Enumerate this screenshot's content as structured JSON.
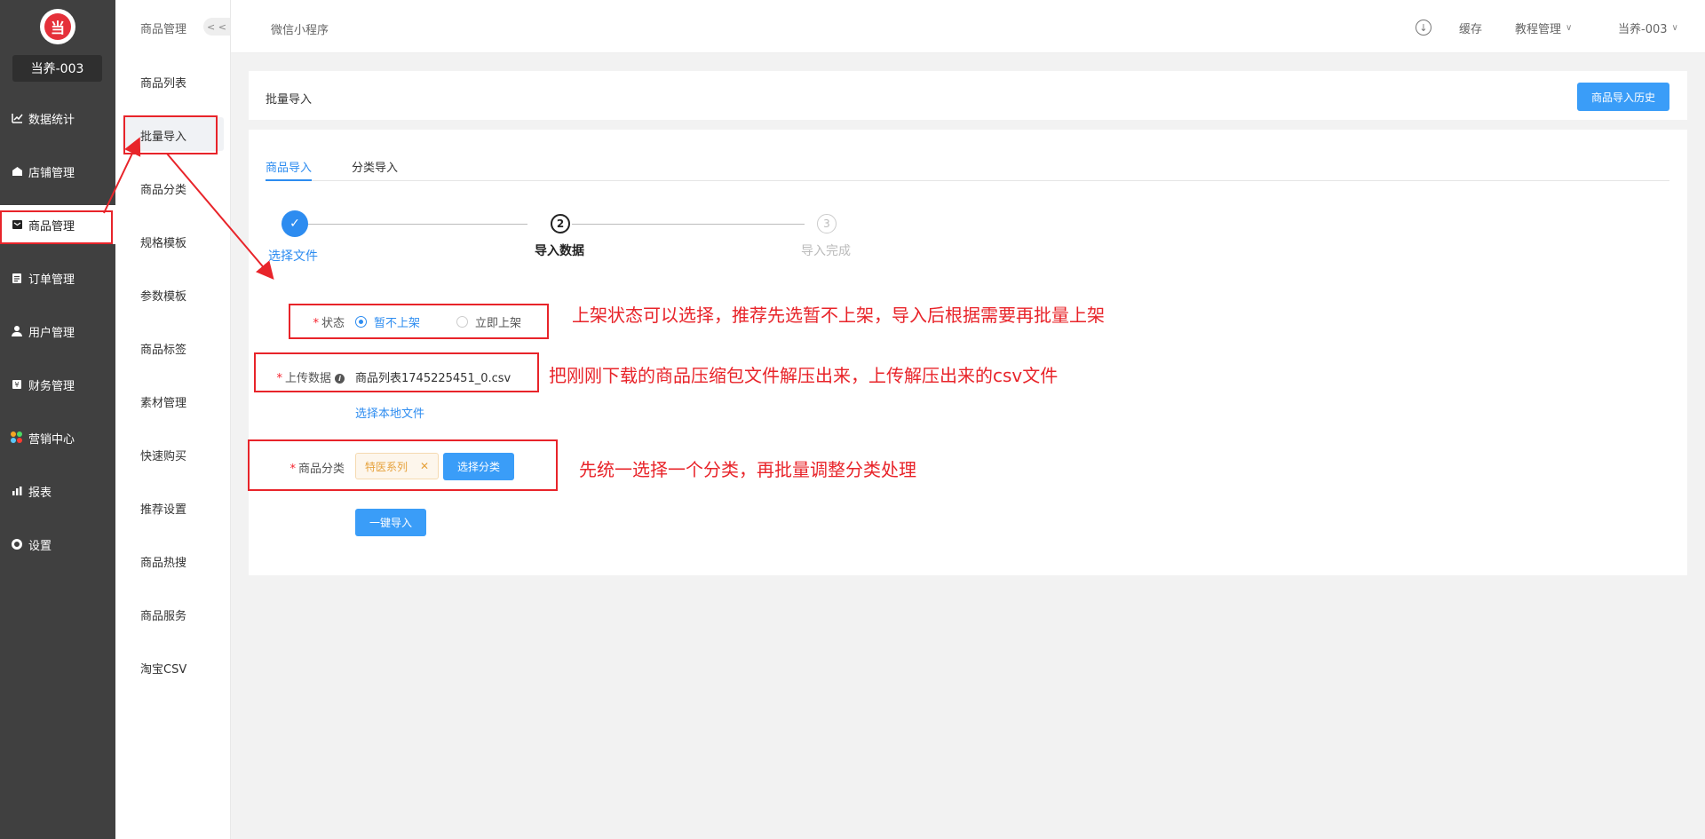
{
  "app": {
    "logo_text": "当",
    "store_name": "当养-003"
  },
  "sidebar": {
    "items": [
      {
        "label": "数据统计",
        "icon": "chart-icon"
      },
      {
        "label": "店铺管理",
        "icon": "store-icon"
      },
      {
        "label": "商品管理",
        "icon": "goods-icon"
      },
      {
        "label": "订单管理",
        "icon": "order-icon"
      },
      {
        "label": "用户管理",
        "icon": "user-icon"
      },
      {
        "label": "财务管理",
        "icon": "finance-icon"
      },
      {
        "label": "营销中心",
        "icon": "marketing-icon"
      },
      {
        "label": "报表",
        "icon": "report-icon"
      },
      {
        "label": "设置",
        "icon": "gear-icon"
      }
    ]
  },
  "submenu": {
    "title": "商品管理",
    "collapse": "< <",
    "items": [
      "商品列表",
      "批量导入",
      "商品分类",
      "规格模板",
      "参数模板",
      "商品标签",
      "素材管理",
      "快速购买",
      "推荐设置",
      "商品热搜",
      "商品服务",
      "淘宝CSV"
    ]
  },
  "topbar": {
    "breadcrumb": "微信小程序",
    "cache": "缓存",
    "tutorial": "教程管理",
    "account": "当养-003"
  },
  "header_panel": {
    "title": "批量导入",
    "history_button": "商品导入历史"
  },
  "tabs": [
    "商品导入",
    "分类导入"
  ],
  "steps": [
    {
      "num": "✓",
      "label": "选择文件"
    },
    {
      "num": "2",
      "label": "导入数据"
    },
    {
      "num": "3",
      "label": "导入完成"
    }
  ],
  "form": {
    "status_label": "状态",
    "status_options": [
      "暂不上架",
      "立即上架"
    ],
    "upload_label": "上传数据",
    "file_name": "商品列表1745225451_0.csv",
    "choose_local": "选择本地文件",
    "category_label": "商品分类",
    "category_tag": "特医系列",
    "choose_category": "选择分类",
    "import_button": "一键导入"
  },
  "annotations": {
    "note1": "上架状态可以选择，推荐先选暂不上架，导入后根据需要再批量上架",
    "note2": "把刚刚下载的商品压缩包文件解压出来，上传解压出来的csv文件",
    "note3": "先统一选择一个分类，再批量调整分类处理"
  },
  "colors": {
    "primary": "#2d8cf0",
    "button": "#3a9df8",
    "annotation": "#e8242a",
    "sidebar_bg": "#404040"
  }
}
